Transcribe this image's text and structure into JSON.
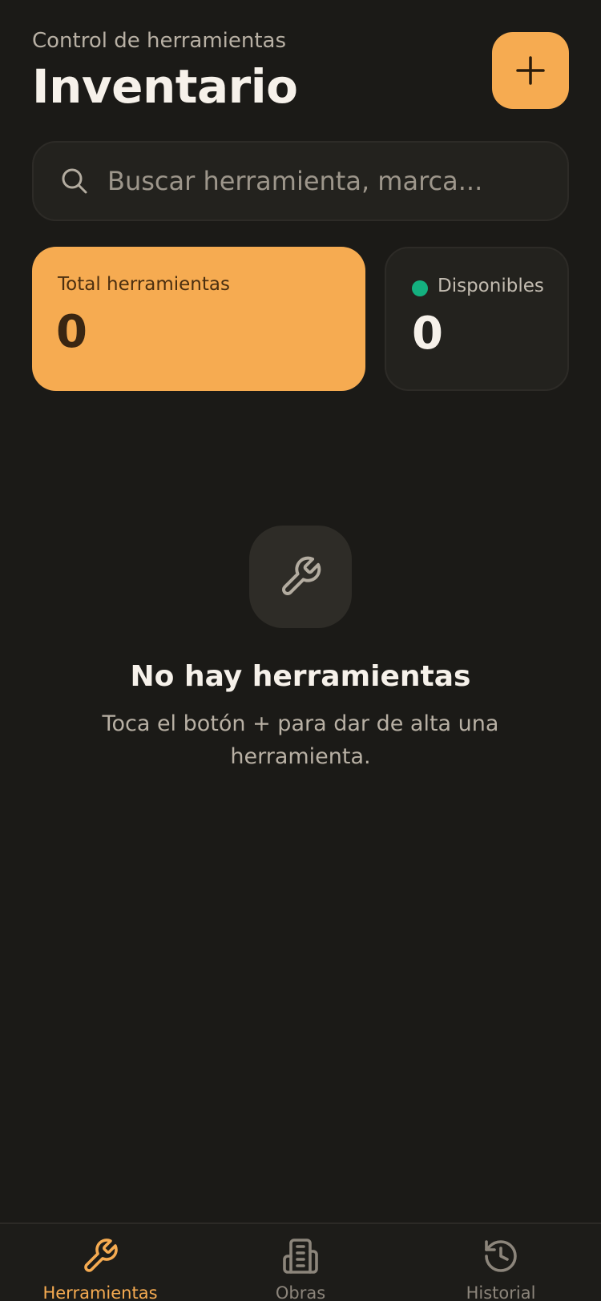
{
  "header": {
    "subtitle": "Control de herramientas",
    "title": "Inventario",
    "add_icon": "plus-icon"
  },
  "search": {
    "placeholder": "Buscar herramienta, marca...",
    "value": "",
    "icon": "search-icon"
  },
  "stats": {
    "total": {
      "label": "Total herramientas",
      "value": "0"
    },
    "available": {
      "label": "Disponibles",
      "value": "0",
      "dot_color": "#14b07f"
    }
  },
  "empty_state": {
    "icon": "wrench-icon",
    "title": "No hay herramientas",
    "text": "Toca el botón + para dar de alta una herramienta."
  },
  "tabs": [
    {
      "label": "Herramientas",
      "icon": "wrench-icon",
      "active": true
    },
    {
      "label": "Obras",
      "icon": "building-icon",
      "active": false
    },
    {
      "label": "Historial",
      "icon": "history-icon",
      "active": false
    }
  ],
  "colors": {
    "background": "#1b1a17",
    "accent": "#f6ab51",
    "card": "#23221e",
    "success": "#14b07f"
  }
}
